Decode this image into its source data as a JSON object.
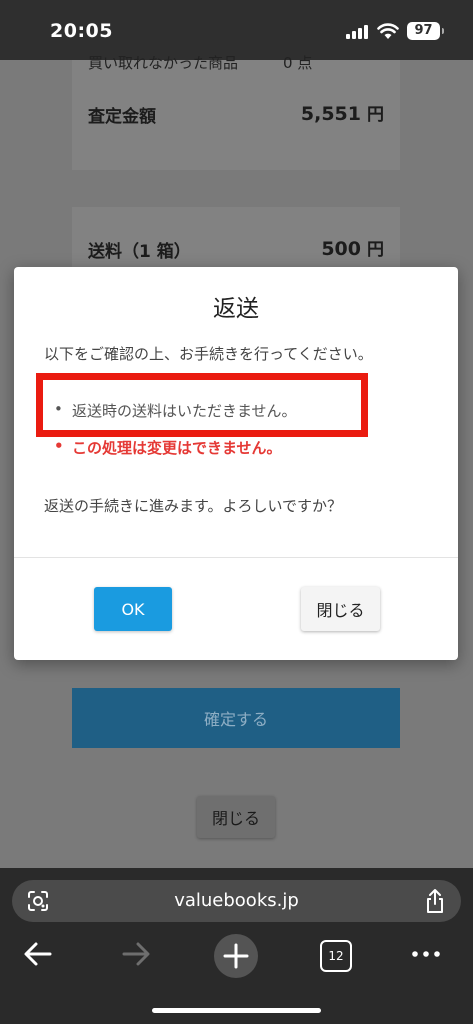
{
  "status_bar": {
    "time": "20:05",
    "battery": "97"
  },
  "page": {
    "cut_text": "買い取れなかった商品　　　0 点",
    "appraisal_label": "査定金額",
    "appraisal_value": "5,551",
    "appraisal_unit": "円",
    "shipping_label": "送料（1 箱）",
    "shipping_value": "500",
    "shipping_unit": "円",
    "confirm_label": "確定する",
    "close_label": "閉じる"
  },
  "modal": {
    "title": "返送",
    "intro": "以下をご確認の上、お手続きを行ってください。",
    "bullets": [
      "返送時の送料はいただきません。",
      "この処理は変更はできません。"
    ],
    "question": "返送の手続きに進みます。よろしいですか？",
    "ok_label": "OK",
    "close_label": "閉じる"
  },
  "browser": {
    "url": "valuebooks.jp",
    "tab_count": "12"
  },
  "colors": {
    "highlight": "#ea1b10",
    "warning": "#e53935",
    "ok_button": "#1a9be0"
  }
}
